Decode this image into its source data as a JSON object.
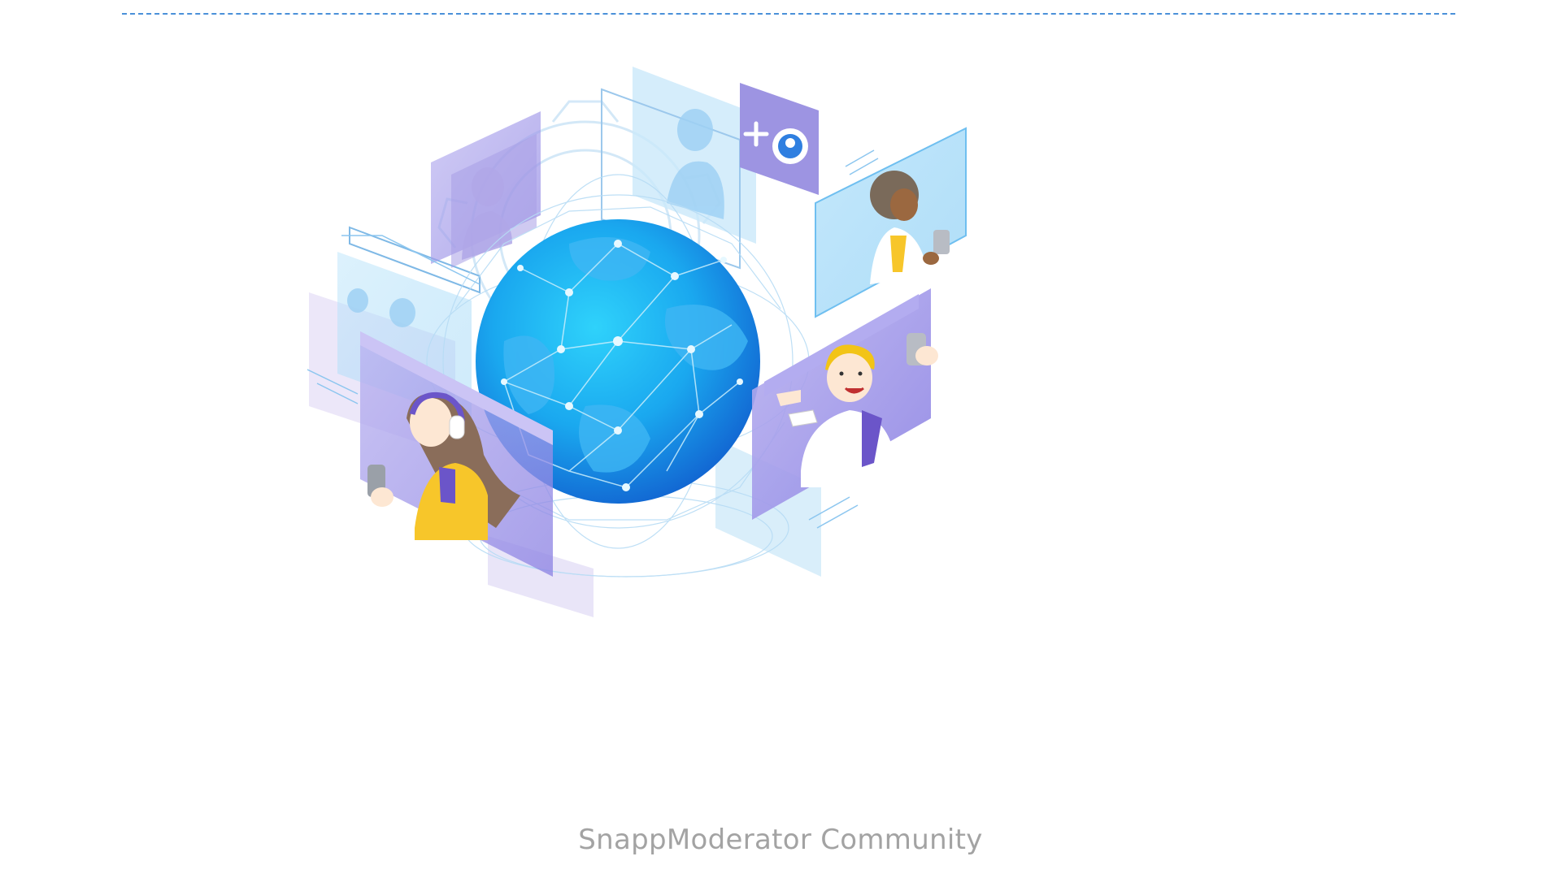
{
  "caption": "SnappModerator Community",
  "colors": {
    "divider": "#4a90d9",
    "globe_light": "#27c6f5",
    "globe_dark": "#1275d6",
    "panel_purple": "#8f86e6",
    "panel_blue": "#8fd4f7",
    "accent_yellow": "#f7c62a",
    "caption_text": "#a3a3a3"
  },
  "icons": [
    "plus-icon",
    "moderator-badge-icon",
    "phone-icon",
    "headphones-icon"
  ]
}
